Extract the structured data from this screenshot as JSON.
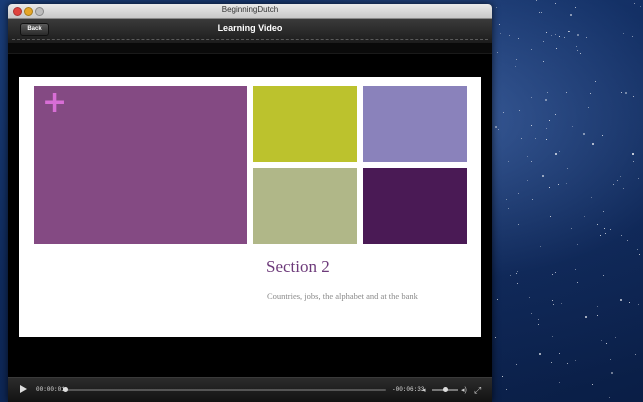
{
  "window": {
    "title": "BeginningDutch"
  },
  "toolbar": {
    "back_label": "Back",
    "title": "Learning Video"
  },
  "slide": {
    "plus_glyph": "+",
    "heading": "Section 2",
    "subheading": "Countries, jobs, the alphabet and at the bank",
    "tile_colors": [
      "#844a83",
      "#bcc22d",
      "#8a82bb",
      "#b0b788",
      "#4a1a55"
    ]
  },
  "player": {
    "elapsed": "00:00:01",
    "remaining": "-00:06:33",
    "progress": 0.003,
    "volume": 0.5
  },
  "icons": {
    "play": "play-icon",
    "volume_low": "volume-low-icon",
    "volume_high": "volume-high-icon",
    "fullscreen": "fullscreen-icon"
  }
}
